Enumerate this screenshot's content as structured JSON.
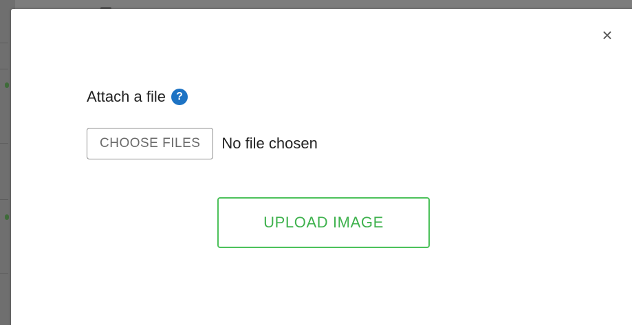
{
  "modal": {
    "close_glyph": "×",
    "attach_label": "Attach a file",
    "help_icon_glyph": "?",
    "choose_button_label": "CHOOSE FILES",
    "file_status": "No file chosen",
    "upload_button_label": "UPLOAD IMAGE"
  },
  "colors": {
    "accent_green": "#4cc15a",
    "help_blue": "#1d73c4",
    "backdrop": "#7d7d7d"
  },
  "icons": {
    "close": "close-icon",
    "help": "help-icon"
  }
}
